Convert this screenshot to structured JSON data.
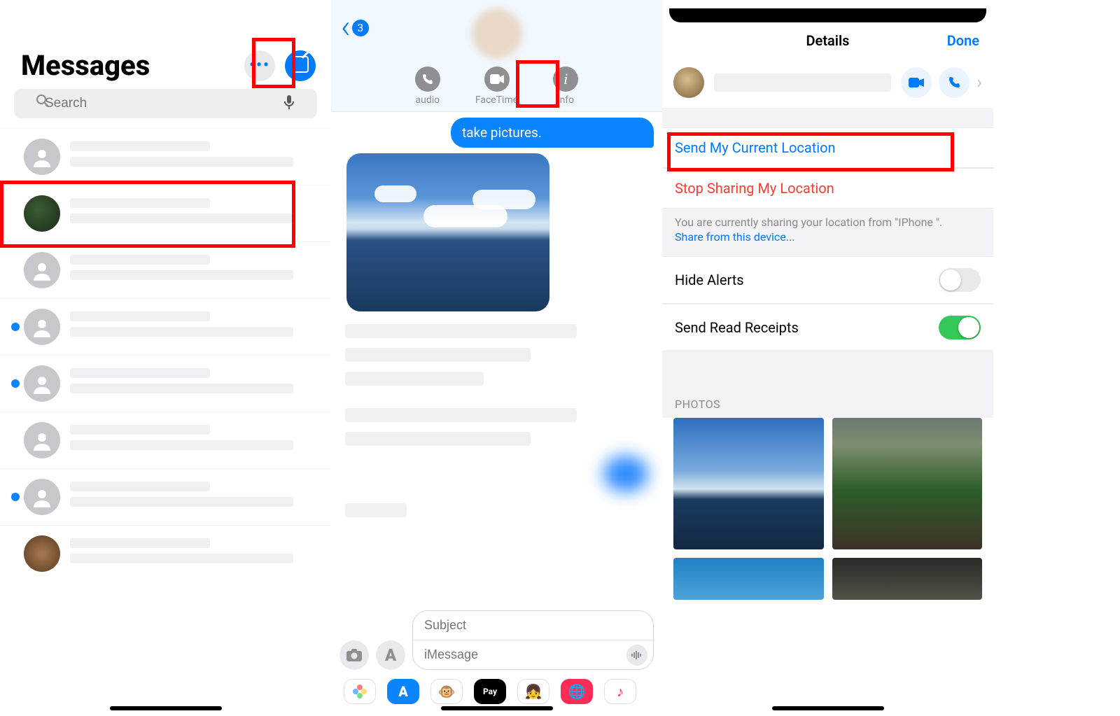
{
  "left": {
    "title": "Messages",
    "search_placeholder": "Search"
  },
  "mid": {
    "back_count": "3",
    "actions": {
      "audio": "audio",
      "facetime": "FaceTime",
      "info": "info"
    },
    "bubble": "take pictures.",
    "subject_placeholder": "Subject",
    "imessage_placeholder": "iMessage"
  },
  "right": {
    "title": "Details",
    "done": "Done",
    "send_location": "Send My Current Location",
    "stop_sharing": "Stop Sharing My Location",
    "note": "You are currently sharing your location from \"IPhone \".",
    "note_link": "Share from this device...",
    "hide_alerts": "Hide Alerts",
    "read_receipts": "Send Read Receipts",
    "photos_label": "PHOTOS"
  }
}
